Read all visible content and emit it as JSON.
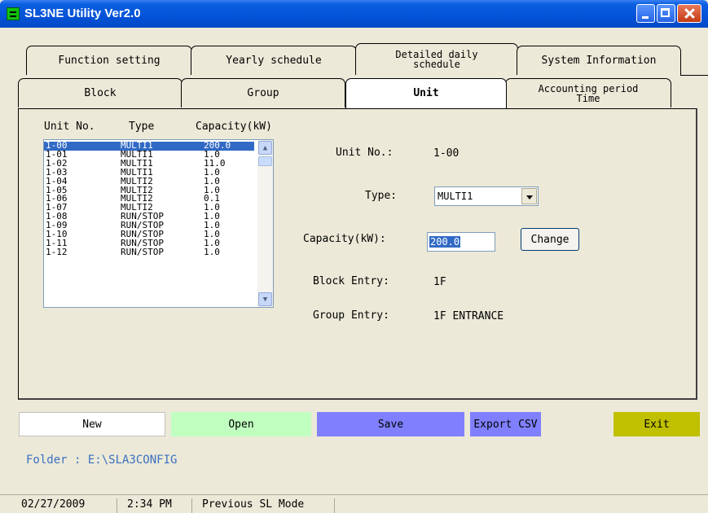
{
  "window": {
    "title": "SL3NE Utility Ver2.0"
  },
  "tabs_back": [
    "Function setting",
    "Yearly schedule",
    "Detailed daily schedule",
    "System Information"
  ],
  "tabs_front": [
    "Block",
    "Group",
    "Unit",
    "Accounting period Time"
  ],
  "unit_list": {
    "headers": {
      "unit_no": "Unit No.",
      "type": "Type",
      "capacity": "Capacity(kW)"
    },
    "rows": [
      {
        "unit": "1-00",
        "type": "MULTI1",
        "capacity": "200.0"
      },
      {
        "unit": "1-01",
        "type": "MULTI1",
        "capacity": "1.0"
      },
      {
        "unit": "1-02",
        "type": "MULTI1",
        "capacity": "11.0"
      },
      {
        "unit": "1-03",
        "type": "MULTI1",
        "capacity": "1.0"
      },
      {
        "unit": "1-04",
        "type": "MULTI2",
        "capacity": "1.0"
      },
      {
        "unit": "1-05",
        "type": "MULTI2",
        "capacity": "1.0"
      },
      {
        "unit": "1-06",
        "type": "MULTI2",
        "capacity": "0.1"
      },
      {
        "unit": "1-07",
        "type": "MULTI2",
        "capacity": "1.0"
      },
      {
        "unit": "1-08",
        "type": "RUN/STOP",
        "capacity": "1.0"
      },
      {
        "unit": "1-09",
        "type": "RUN/STOP",
        "capacity": "1.0"
      },
      {
        "unit": "1-10",
        "type": "RUN/STOP",
        "capacity": "1.0"
      },
      {
        "unit": "1-11",
        "type": "RUN/STOP",
        "capacity": "1.0"
      },
      {
        "unit": "1-12",
        "type": "RUN/STOP",
        "capacity": "1.0"
      }
    ]
  },
  "detail": {
    "unit_no_label": "Unit No.:",
    "unit_no_value": "1-00",
    "type_label": "Type:",
    "type_value": "MULTI1",
    "capacity_label": "Capacity(kW):",
    "capacity_value": "200.0",
    "change_label": "Change",
    "block_label": "Block Entry:",
    "block_value": "1F",
    "group_label": "Group Entry:",
    "group_value": "1F ENTRANCE"
  },
  "buttons": {
    "new": "New",
    "open": "Open",
    "save": "Save",
    "export": "Export CSV",
    "exit": "Exit"
  },
  "colors": {
    "new": "#ffffff",
    "open": "#c0ffc0",
    "save": "#8080ff",
    "export": "#8080ff",
    "exit": "#c0c000",
    "selection": "#316ac5",
    "titlebar": "#0552d8"
  },
  "folder": "Folder : E:\\SLA3CONFIG",
  "status": {
    "date": "02/27/2009",
    "time": "2:34 PM",
    "mode": "Previous SL Mode"
  }
}
